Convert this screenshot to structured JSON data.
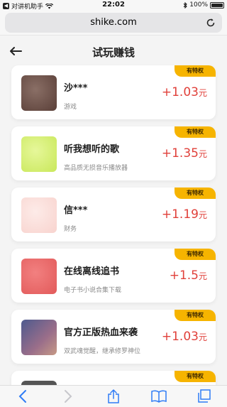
{
  "status_bar": {
    "carrier": "对讲机助手",
    "time": "22:02",
    "battery": "100%"
  },
  "browser": {
    "url": "shike.com"
  },
  "header": {
    "title": "试玩赚钱"
  },
  "apps": [
    {
      "name": "沙***",
      "desc": "游戏",
      "reward": "+1.03",
      "unit": "元",
      "badge": "有特权",
      "thumb_color": "#6b5048"
    },
    {
      "name": "听我想听的歌",
      "desc": "高品质无损音乐播放器",
      "reward": "+1.35",
      "unit": "元",
      "badge": "有特权",
      "thumb_color": "#d7f07a"
    },
    {
      "name": "信***",
      "desc": "财务",
      "reward": "+1.19",
      "unit": "元",
      "badge": "有特权",
      "thumb_color": "#fbe0dd"
    },
    {
      "name": "在线离线追书",
      "desc": "电子书小说合集下载",
      "reward": "+1.5",
      "unit": "元",
      "badge": "有特权",
      "thumb_color": "#ef6b6b"
    },
    {
      "name": "官方正版热血来袭",
      "desc": "双武魂觉醒，继承修罗神位",
      "reward": "+1.03",
      "unit": "元",
      "badge": "有特权",
      "thumb_color": "#6a5d8e"
    }
  ],
  "partial_card": {
    "badge": "有特权"
  },
  "toolbar_icons": [
    "back-arrow-icon",
    "forward-arrow-icon",
    "share-icon",
    "bookmarks-icon",
    "tabs-icon"
  ]
}
